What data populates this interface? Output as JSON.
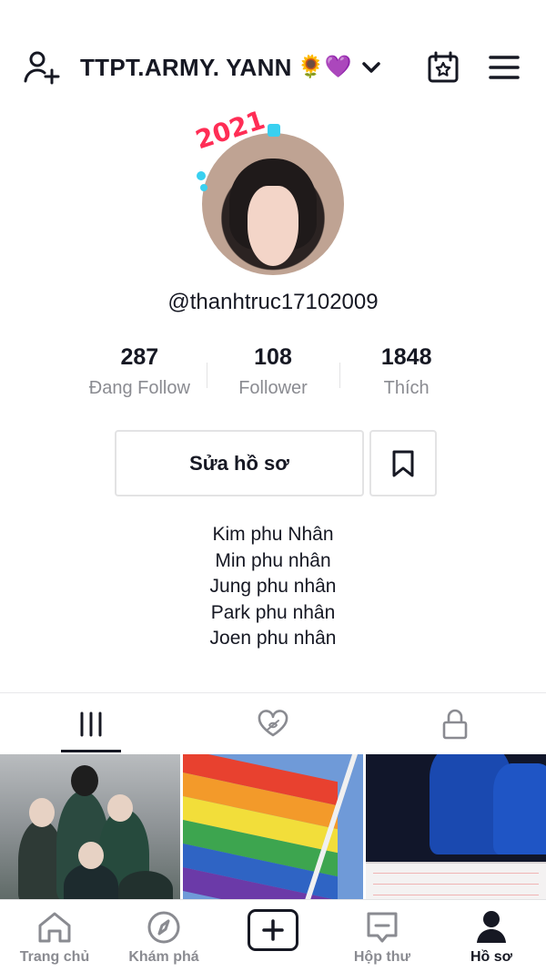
{
  "header": {
    "title": "TTPT.ARMY. YANN",
    "emojis": "🌻💜"
  },
  "profile": {
    "avatar_badge": "2021",
    "username": "@thanhtruc17102009"
  },
  "stats": [
    {
      "value": "287",
      "label": "Đang Follow"
    },
    {
      "value": "108",
      "label": "Follower"
    },
    {
      "value": "1848",
      "label": "Thích"
    }
  ],
  "actions": {
    "edit_label": "Sửa hồ sơ"
  },
  "bio": [
    "Kim phu Nhân",
    "Min phu nhân",
    "Jung phu nhân",
    "Park phu nhân",
    "Joen phu nhân"
  ],
  "tabs": {
    "items": [
      "videos-grid-icon",
      "liked-hidden-icon",
      "lock-icon"
    ],
    "active": 0
  },
  "bottom_nav": [
    {
      "label": "Trang chủ",
      "icon": "home-icon",
      "active": false
    },
    {
      "label": "Khám phá",
      "icon": "compass-icon",
      "active": false
    },
    {
      "label": "",
      "icon": "plus-icon",
      "active": false
    },
    {
      "label": "Hộp thư",
      "icon": "inbox-icon",
      "active": false
    },
    {
      "label": "Hồ sơ",
      "icon": "profile-icon",
      "active": true
    }
  ],
  "colors": {
    "text": "#161823",
    "muted": "#8a8b91",
    "border": "#e3e3e4",
    "badge": "#ff2d55"
  }
}
